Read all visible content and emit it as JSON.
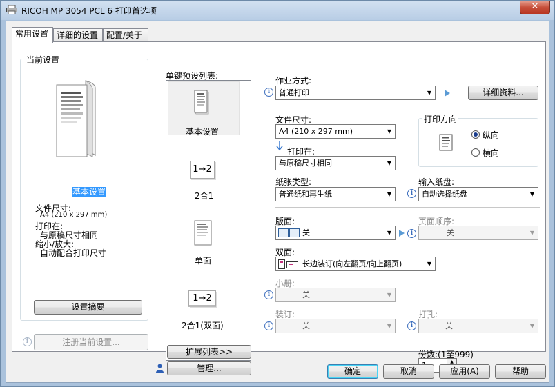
{
  "window": {
    "title": "RICOH MP 3054 PCL 6 打印首选项",
    "close_glyph": "✕"
  },
  "tabs": [
    {
      "label": "常用设置"
    },
    {
      "label": "详细的设置"
    },
    {
      "label": "配置/关于"
    }
  ],
  "current_settings": {
    "group_title": "当前设置",
    "preset_name": "基本设置",
    "paper_size_label": "文件尺寸:",
    "paper_size_value": "A4 (210 x 297 mm)",
    "print_on_label": "打印在:",
    "print_on_value": "与原稿尺寸相同",
    "zoom_label": "缩小/放大:",
    "zoom_value": "自动配合打印尺寸",
    "summary_button": "设置摘要",
    "register_button": "注册当前设置..."
  },
  "presets": {
    "title": "单键预设列表:",
    "items": [
      {
        "label": "基本设置",
        "icon": "document-icon"
      },
      {
        "label": "2合1",
        "icon": "two-in-one-icon",
        "glyph": "1→2"
      },
      {
        "label": "单面",
        "icon": "single-sided-icon"
      },
      {
        "label": "2合1(双面)",
        "icon": "two-in-one-duplex-icon",
        "glyph": "1→2"
      }
    ],
    "expand_button": "扩展列表>>",
    "manage_button": "管理..."
  },
  "job_type": {
    "label": "作业方式:",
    "value": "普通打印",
    "details_button": "详细资料..."
  },
  "document_size": {
    "label": "文件尺寸:",
    "value": "A4 (210 x 297 mm)"
  },
  "print_on": {
    "label": "打印在:",
    "value": "与原稿尺寸相同"
  },
  "orientation": {
    "title": "打印方向",
    "portrait": "纵向",
    "landscape": "横向",
    "selected": "portrait"
  },
  "paper_type": {
    "label": "纸张类型:",
    "value": "普通纸和再生纸"
  },
  "input_tray": {
    "label": "输入纸盘:",
    "value": "自动选择纸盘"
  },
  "layout": {
    "label": "版面:",
    "value": "关"
  },
  "page_order": {
    "label": "页面顺序:",
    "value": "关"
  },
  "duplex": {
    "label": "双面:",
    "value": "长边装订(向左翻页/向上翻页)"
  },
  "booklet": {
    "label": "小册:",
    "value": "关"
  },
  "binding": {
    "label": "装订:",
    "value": "关"
  },
  "punch": {
    "label": "打孔:",
    "value": "关"
  },
  "copies": {
    "label": "份数:(1至999)",
    "value": "1"
  },
  "dialog_buttons": {
    "ok": "确定",
    "cancel": "取消",
    "apply": "应用(A)",
    "help": "帮助"
  },
  "colors": {
    "selection": "#3399ff",
    "info": "#3b6dbd",
    "arrow": "#5b9bd5"
  }
}
